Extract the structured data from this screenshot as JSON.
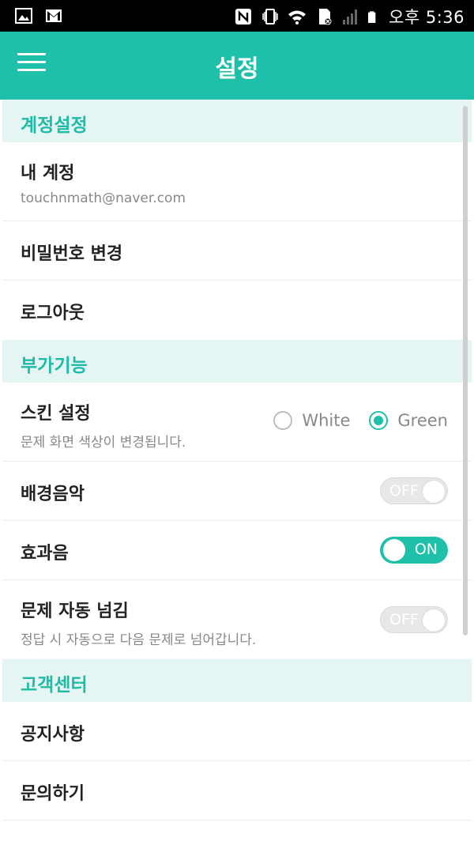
{
  "status_bar": {
    "time": "오후 5:36",
    "left_icons": [
      "gallery-icon",
      "gmail-icon"
    ],
    "right_icons": [
      "nfc-icon",
      "vibrate-icon",
      "wifi-icon",
      "sd-card-icon",
      "signal-icon",
      "battery-icon"
    ]
  },
  "app_bar": {
    "title": "설정",
    "menu_icon": "hamburger-menu-icon",
    "color": "#1ec0aa"
  },
  "sections": {
    "account": {
      "header": "계정설정",
      "my_account_title": "내 계정",
      "my_account_email": "touchnmath@naver.com",
      "change_password": "비밀번호 변경",
      "logout": "로그아웃"
    },
    "extras": {
      "header": "부가기능",
      "skin_title": "스킨 설정",
      "skin_desc": "문제 화면 색상이 변경됩니다.",
      "skin_options": [
        "White",
        "Green"
      ],
      "skin_selected": "Green",
      "bgm_title": "배경음악",
      "bgm_state": "OFF",
      "sfx_title": "효과음",
      "sfx_state": "ON",
      "auto_next_title": "문제 자동 넘김",
      "auto_next_desc": "정답 시 자동으로 다음 문제로 넘어갑니다.",
      "auto_next_state": "OFF"
    },
    "support": {
      "header": "고객센터",
      "notice": "공지사항",
      "inquiry": "문의하기"
    }
  },
  "colors": {
    "accent": "#1ec0aa",
    "section_bg": "#e5f5f3"
  }
}
